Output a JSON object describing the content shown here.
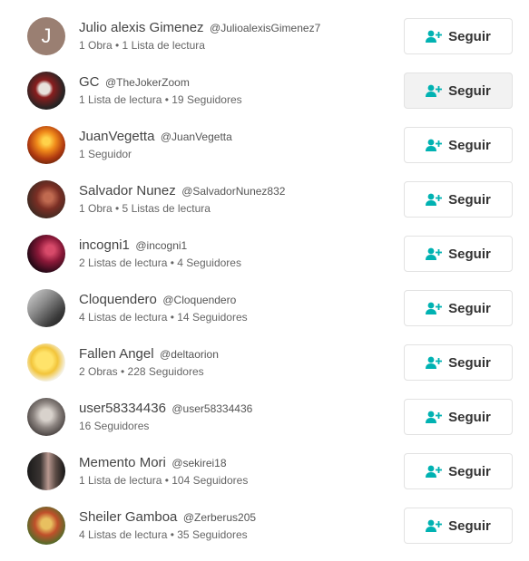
{
  "accent_color": "#00b2b2",
  "follow_icon": "person-add-icon",
  "users": [
    {
      "name": "Julio alexis Gimenez",
      "handle": "@JulioalexisGimenez7",
      "stats": "1 Obra • 1 Lista de lectura",
      "avatar_letter": "J",
      "button_label": "Seguir"
    },
    {
      "name": "GC",
      "handle": "@TheJokerZoom",
      "stats": "1 Lista de lectura • 19 Seguidores",
      "button_label": "Seguir"
    },
    {
      "name": "JuanVegetta",
      "handle": "@JuanVegetta",
      "stats": "1 Seguidor",
      "button_label": "Seguir"
    },
    {
      "name": "Salvador Nunez",
      "handle": "@SalvadorNunez832",
      "stats": "1 Obra • 5 Listas de lectura",
      "button_label": "Seguir"
    },
    {
      "name": "incogni1",
      "handle": "@incogni1",
      "stats": "2 Listas de lectura • 4 Seguidores",
      "button_label": "Seguir"
    },
    {
      "name": "Cloquendero",
      "handle": "@Cloquendero",
      "stats": "4 Listas de lectura • 14 Seguidores",
      "button_label": "Seguir"
    },
    {
      "name": "Fallen Angel",
      "handle": "@deltaorion",
      "stats": "2 Obras • 228 Seguidores",
      "button_label": "Seguir"
    },
    {
      "name": "user58334436",
      "handle": "@user58334436",
      "stats": "16 Seguidores",
      "button_label": "Seguir"
    },
    {
      "name": "Memento Mori",
      "handle": "@sekirei18",
      "stats": "1 Lista de lectura • 104 Seguidores",
      "button_label": "Seguir"
    },
    {
      "name": "Sheiler Gamboa",
      "handle": "@Zerberus205",
      "stats": "4 Listas de lectura • 35 Seguidores",
      "button_label": "Seguir"
    }
  ]
}
